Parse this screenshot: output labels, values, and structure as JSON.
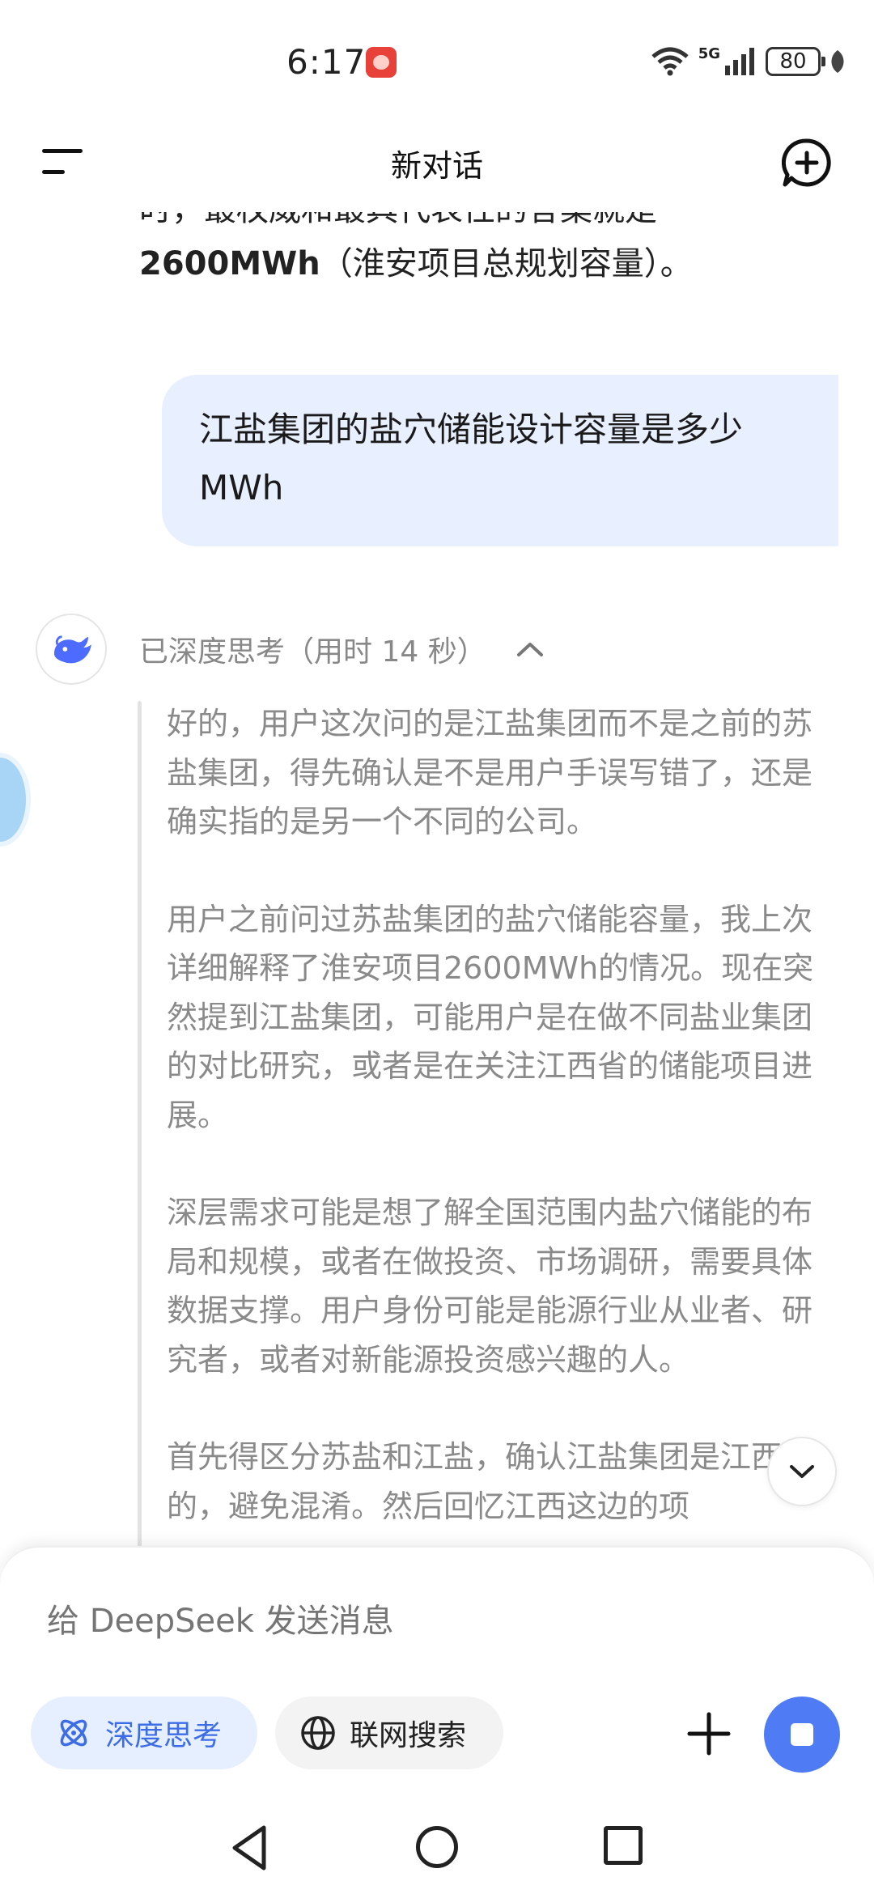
{
  "status_bar": {
    "time": "6:17",
    "network": "5G",
    "battery": "80"
  },
  "header": {
    "title": "新对话",
    "menu_icon": "menu-icon",
    "new_chat_icon": "new-chat-icon"
  },
  "messages": {
    "previous_answer_cut": "时，最权威和最具代表性的答案就是",
    "previous_answer_bold": "2600MWh",
    "previous_answer_rest": "（淮安项目总规划容量）。",
    "user_question": "江盐集团的盐穴储能设计容量是多少MWh",
    "thinking_header": "已深度思考（用时 14 秒）",
    "thinking_paragraphs": [
      "好的，用户这次问的是江盐集团而不是之前的苏盐集团，得先确认是不是用户手误写错了，还是确实指的是另一个不同的公司。",
      "用户之前问过苏盐集团的盐穴储能容量，我上次详细解释了淮安项目2600MWh的情况。现在突然提到江盐集团，可能用户是在做不同盐业集团的对比研究，或者是在关注江西省的储能项目进展。",
      "深层需求可能是想了解全国范围内盐穴储能的布局和规模，或者在做投资、市场调研，需要具体数据支撑。用户身份可能是能源行业从业者、研究者，或者对新能源投资感兴趣的人。",
      "首先得区分苏盐和江盐，确认江盐集团是江西省的，避免混淆。然后回忆江西这边的项"
    ]
  },
  "composer": {
    "placeholder": "给 DeepSeek 发送消息",
    "deep_think_label": "深度思考",
    "web_search_label": "联网搜索"
  },
  "colors": {
    "accent": "#4f7cf5",
    "user_bubble": "#e8efff",
    "thinking_text": "#8a8a8a"
  }
}
